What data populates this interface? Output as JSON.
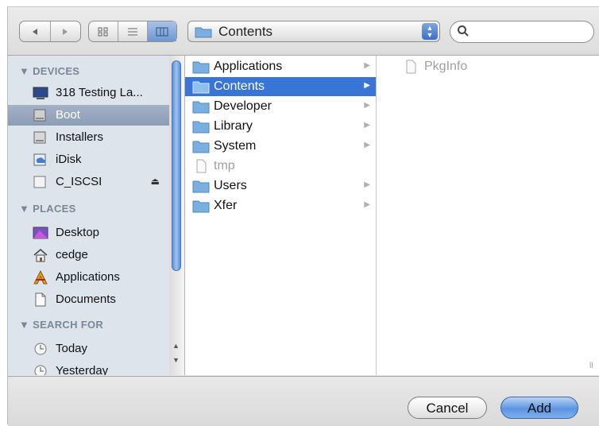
{
  "toolbar": {
    "nav_back_icon": "back-arrow",
    "nav_forward_icon": "forward-arrow",
    "view_modes": [
      "icon-view",
      "list-view",
      "column-view"
    ],
    "location_popup": "Contents",
    "search_placeholder": ""
  },
  "sidebar": {
    "devices_header": "DEVICES",
    "devices": [
      {
        "label": "318 Testing La...",
        "icon": "computer-icon"
      },
      {
        "label": "Boot",
        "icon": "harddisk-icon",
        "selected": true
      },
      {
        "label": "Installers",
        "icon": "harddisk-icon"
      },
      {
        "label": "iDisk",
        "icon": "idisk-icon"
      },
      {
        "label": "C_ISCSI",
        "icon": "drive-icon",
        "eject": true
      }
    ],
    "places_header": "PLACES",
    "places": [
      {
        "label": "Desktop",
        "icon": "desktop-icon"
      },
      {
        "label": "cedge",
        "icon": "home-icon"
      },
      {
        "label": "Applications",
        "icon": "applications-icon"
      },
      {
        "label": "Documents",
        "icon": "documents-icon"
      }
    ],
    "search_header": "SEARCH FOR",
    "searches": [
      {
        "label": "Today",
        "icon": "clock-icon"
      },
      {
        "label": "Yesterday",
        "icon": "clock-icon"
      }
    ]
  },
  "browser": {
    "column1": [
      {
        "label": "Applications",
        "type": "folder",
        "selected": false
      },
      {
        "label": "Contents",
        "type": "folder",
        "selected": true
      },
      {
        "label": "Developer",
        "type": "folder",
        "selected": false
      },
      {
        "label": "Library",
        "type": "folder",
        "selected": false
      },
      {
        "label": "System",
        "type": "folder",
        "selected": false
      },
      {
        "label": "tmp",
        "type": "file",
        "selected": false
      },
      {
        "label": "Users",
        "type": "folder",
        "selected": false
      },
      {
        "label": "Xfer",
        "type": "folder",
        "selected": false
      }
    ],
    "column2": [
      {
        "label": "PkgInfo",
        "type": "file"
      }
    ]
  },
  "buttons": {
    "cancel": "Cancel",
    "add": "Add"
  },
  "colors": {
    "selection_blue": "#3875d7",
    "sidebar_bg": "#dde4ec",
    "sidebar_selected": "#8b9cb5"
  }
}
